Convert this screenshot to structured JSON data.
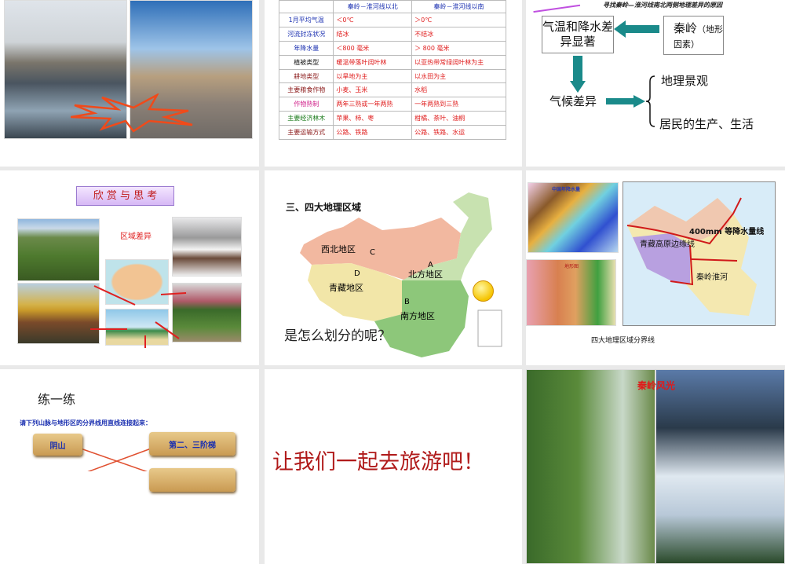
{
  "slides": {
    "s1": {
      "photos": [
        "water-town-canal-photo",
        "cave-dwelling-photo"
      ]
    },
    "s2": {
      "table": {
        "headers": [
          "",
          "秦岭－淮河线以北",
          "秦岭－淮河线以南"
        ],
        "rows": [
          {
            "label": "1月平均气温",
            "north": "＜0℃",
            "south": "＞0℃",
            "color": "#1a2fb0"
          },
          {
            "label": "河流封冻状况",
            "north": "结冰",
            "south": "不结冰",
            "color": "#1a2fb0"
          },
          {
            "label": "年降水量",
            "north": "＜800 毫米",
            "south": "＞ 800 毫米",
            "color": "#1a2fb0"
          },
          {
            "label": "植被类型",
            "north": "暖温带落叶阔叶林",
            "south": "以亚热带常绿阔叶林为主",
            "color": "#111111"
          },
          {
            "label": "耕地类型",
            "north": "以旱地为主",
            "south": "以水田为主",
            "color": "#8b1a1a"
          },
          {
            "label": "主要粮食作物",
            "north": "小麦、玉米",
            "south": "水稻",
            "color": "#8b1a1a"
          },
          {
            "label": "作物熟制",
            "north": "两年三熟或一年两熟",
            "south": "一年两熟到三熟",
            "color": "#d0208a"
          },
          {
            "label": "主要经济林木",
            "north": "苹果、柿、枣",
            "south": "柑橘、茶叶、油桐",
            "color": "#1a7a1a"
          },
          {
            "label": "主要运输方式",
            "north": "公路、铁路",
            "south": "公路、铁路、水运",
            "color": "#8b1a1a"
          }
        ],
        "value_color": "#e02020"
      }
    },
    "s3": {
      "subtitle": "寻找秦岭—淮河线南北两侧地理差异的原因",
      "box1": "气温和降水差异显著",
      "box2_main": "秦岭",
      "box2_note": "（地形因素）",
      "climate": "气候差异",
      "effect1": "地理景观",
      "effect2": "居民的生产、生活",
      "arrow_color": "#1a8a8a"
    },
    "s4": {
      "banner": "欣 赏 与 思 考",
      "label": "区域差异"
    },
    "s5": {
      "title": "三、四大地理区域",
      "regions": [
        {
          "name": "西北地区",
          "letter": "C"
        },
        {
          "name": "青藏地区",
          "letter": "D"
        },
        {
          "name": "北方地区",
          "letter": "A"
        },
        {
          "name": "南方地区",
          "letter": "B"
        }
      ],
      "question": "是怎么划分的呢？"
    },
    "s6": {
      "line1": "400mm 等降水量线",
      "line2": "青藏高原边缘线",
      "line3": "秦岭淮河",
      "map_title": "中国年降水量",
      "terrain_title": "地形图",
      "caption": "四大地理区域分界线"
    },
    "s7": {
      "title": "练一练",
      "instruction": "请下列山脉与地形区的分界线用直线连接起来：",
      "left_items": [
        "阴山"
      ],
      "right_items": [
        "第二、三阶梯"
      ]
    },
    "s8": {
      "text": "让我们一起去旅游吧！"
    },
    "s9": {
      "caption": "秦岭风光"
    }
  }
}
